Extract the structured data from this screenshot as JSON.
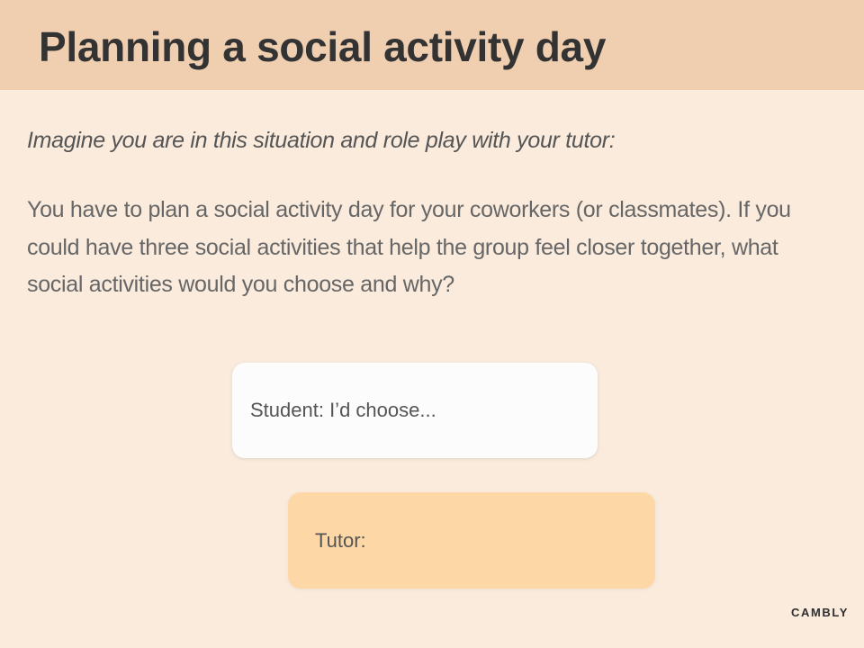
{
  "slide": {
    "title": "Planning a social activity day",
    "instruction": "Imagine you are in this situation and role play with your tutor:",
    "prompt": "You have to plan a social activity day for your coworkers (or classmates). If you could have three social activities that help the group feel closer together, what social activities would you choose and why?"
  },
  "dialogue": {
    "student_line": "Student: I’d choose...",
    "tutor_line": "Tutor:"
  },
  "brand": {
    "logo_text": "CAMBLY"
  },
  "colors": {
    "background": "#faebdd",
    "header": "#f0cfb0",
    "student_bubble": "#fcfcfc",
    "tutor_bubble": "#fdd8a6"
  }
}
